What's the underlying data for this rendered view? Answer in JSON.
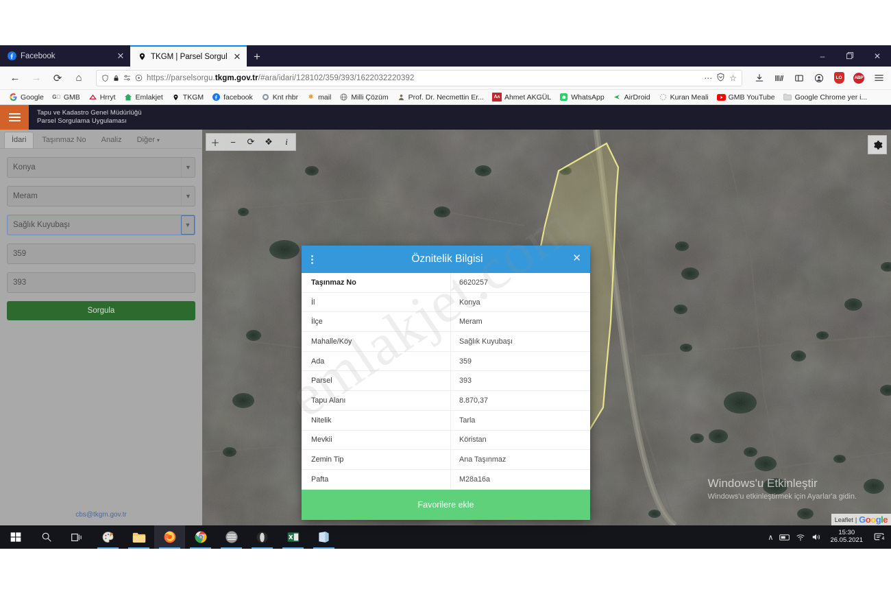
{
  "browser": {
    "tabs": [
      {
        "title": "Facebook",
        "icon": "facebook-icon",
        "active": false
      },
      {
        "title": "TKGM | Parsel Sorgulama Uygu",
        "icon": "map-pin-icon",
        "active": true
      }
    ],
    "new_tab_label": "+",
    "window_controls": {
      "minimize": "–",
      "maximize": "❐",
      "close": "✕"
    },
    "nav": {
      "back": "←",
      "forward": "→",
      "reload": "⟳",
      "home": "⌂"
    },
    "url": {
      "scheme": "https://",
      "host_prefix": "parselsorgu.",
      "host_bold": "tkgm.gov.tr",
      "path": "/#ara/idari/128102/359/393/1622032220392",
      "full": "https://parselsorgu.tkgm.gov.tr/#ara/idari/128102/359/393/1622032220392"
    },
    "toolbar_icons": [
      "downloads-icon",
      "library-icon",
      "sidebar-icon",
      "account-icon",
      "lastpass-icon",
      "adblock-plus-icon",
      "hamburger-menu-icon"
    ],
    "adblock_label": "ABP",
    "lastpass_label": "LO",
    "bookmarks": [
      {
        "label": "Google",
        "icon": "google-icon"
      },
      {
        "label": "GMB",
        "icon": "gmb-icon"
      },
      {
        "label": "Hrryt",
        "icon": "hurriyet-icon"
      },
      {
        "label": "Emlakjet",
        "icon": "emlakjet-icon"
      },
      {
        "label": "TKGM",
        "icon": "map-pin-icon"
      },
      {
        "label": "facebook",
        "icon": "facebook-icon"
      },
      {
        "label": "Knt rhbr",
        "icon": "kent-rehberi-icon"
      },
      {
        "label": "mail",
        "icon": "mail-icon"
      },
      {
        "label": "Milli Çözüm",
        "icon": "globe-icon"
      },
      {
        "label": "Prof. Dr. Necmettin Er...",
        "icon": "person-icon"
      },
      {
        "label": "Ahmet AKGÜL",
        "icon": "akgul-icon"
      },
      {
        "label": "WhatsApp",
        "icon": "whatsapp-icon"
      },
      {
        "label": "AirDroid",
        "icon": "airdroid-icon"
      },
      {
        "label": "Kuran Meali",
        "icon": "kuran-icon"
      },
      {
        "label": "GMB YouTube",
        "icon": "youtube-icon"
      },
      {
        "label": "Google Chrome yer i...",
        "icon": "folder-icon"
      }
    ]
  },
  "app": {
    "header": {
      "line1": "Tapu ve Kadastro Genel Müdürlüğü",
      "line2": "Parsel Sorgulama Uygulaması",
      "menu_icon": "hamburger-menu-icon"
    },
    "sidebar": {
      "tabs": [
        {
          "label": "İdari",
          "active": true
        },
        {
          "label": "Taşınmaz No",
          "active": false
        },
        {
          "label": "Analiz",
          "active": false
        },
        {
          "label": "Diğer",
          "active": false,
          "caret": "▾"
        }
      ],
      "fields": [
        {
          "name": "il-select",
          "type": "select",
          "value": "Konya"
        },
        {
          "name": "ilce-select",
          "type": "select",
          "value": "Meram"
        },
        {
          "name": "mahalle-select",
          "type": "select",
          "value": "Sağlık Kuyubaşı",
          "focused": true
        },
        {
          "name": "ada-input",
          "type": "text",
          "value": "359"
        },
        {
          "name": "parsel-input",
          "type": "text",
          "value": "393"
        }
      ],
      "submit_label": "Sorgula",
      "footer_link": "cbs@tkgm.gov.tr"
    },
    "map": {
      "toolbar": [
        {
          "icon": "zoom-in-icon",
          "glyph": "＋"
        },
        {
          "icon": "zoom-out-icon",
          "glyph": "−"
        },
        {
          "icon": "refresh-icon",
          "glyph": "⟳"
        },
        {
          "icon": "locate-icon",
          "glyph": "❖"
        },
        {
          "icon": "info-icon",
          "glyph": "i"
        }
      ],
      "settings_icon": "gear-icon",
      "attribution": {
        "leaflet": "Leaflet",
        "separator": "|",
        "google": "Google"
      },
      "watermark": "emlakjet.com"
    },
    "modal": {
      "title": "Öznitelik Bilgisi",
      "menu_icon": "kebab-menu-icon",
      "close_icon": "close-icon",
      "rows": [
        {
          "key": "Taşınmaz No",
          "value": "6620257"
        },
        {
          "key": "İl",
          "value": "Konya"
        },
        {
          "key": "İlçe",
          "value": "Meram"
        },
        {
          "key": "Mahalle/Köy",
          "value": "Sağlık Kuyubaşı"
        },
        {
          "key": "Ada",
          "value": "359"
        },
        {
          "key": "Parsel",
          "value": "393"
        },
        {
          "key": "Tapu Alanı",
          "value": "8.870,37"
        },
        {
          "key": "Nitelik",
          "value": "Tarla"
        },
        {
          "key": "Mevkii",
          "value": "Köristan"
        },
        {
          "key": "Zemin Tip",
          "value": "Ana Taşınmaz"
        },
        {
          "key": "Pafta",
          "value": "M28a16a"
        }
      ],
      "footer_label": "Favorilere ekle"
    }
  },
  "windows": {
    "activation": {
      "title": "Windows'u Etkinleştir",
      "subtitle": "Windows'u etkinleştirmek için Ayarlar'a gidin."
    },
    "taskbar": {
      "items": [
        {
          "name": "start-button",
          "icon": "windows-logo-icon"
        },
        {
          "name": "search-button",
          "icon": "search-icon"
        },
        {
          "name": "task-view-button",
          "icon": "task-view-icon"
        },
        {
          "name": "paint-app",
          "icon": "paint-icon"
        },
        {
          "name": "file-explorer-app",
          "icon": "folder-icon"
        },
        {
          "name": "firefox-app",
          "icon": "firefox-icon"
        },
        {
          "name": "chrome-app",
          "icon": "chrome-icon"
        },
        {
          "name": "browser-app",
          "icon": "tor-browser-icon"
        },
        {
          "name": "opera-app",
          "icon": "opera-icon"
        },
        {
          "name": "excel-app",
          "icon": "excel-icon"
        },
        {
          "name": "notes-app",
          "icon": "notes-icon"
        }
      ],
      "tray": {
        "chevron": "∧",
        "icons": [
          "keyboard-icon",
          "wifi-icon",
          "volume-icon"
        ],
        "time": "15:30",
        "date": "26.05.2021",
        "notification_count": "4"
      }
    }
  },
  "colors": {
    "accent_blue": "#3498db",
    "green_button": "#5ed17a",
    "sorgula_green": "#2d6a2d",
    "orange": "#d2622a",
    "app_dark": "#1b1b2b",
    "parcel_yellow": "#e8e07a"
  }
}
